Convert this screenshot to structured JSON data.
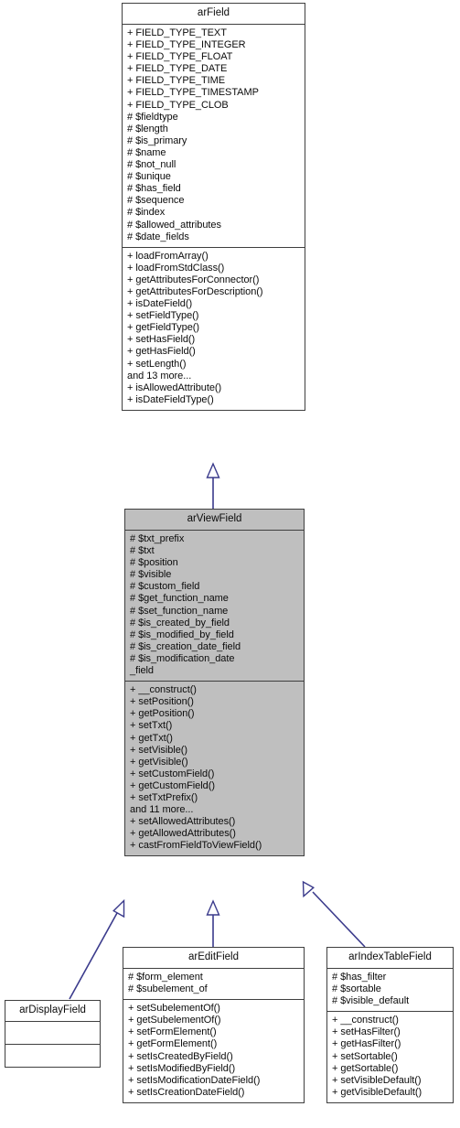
{
  "diagram": {
    "kind": "uml-class-inheritance-diagram",
    "title": "arField class hierarchy",
    "colors": {
      "node_border": "#3f3f3f",
      "node_background": "#ffffff",
      "highlight_background": "#bfbfbf",
      "edge_line": "#3b3b8c",
      "text": "#0b0b0b",
      "canvas": "#ffffff"
    }
  },
  "nodes": {
    "ar_field": {
      "name": "arField",
      "attributes": [
        "+ FIELD_TYPE_TEXT",
        "+ FIELD_TYPE_INTEGER",
        "+ FIELD_TYPE_FLOAT",
        "+ FIELD_TYPE_DATE",
        "+ FIELD_TYPE_TIME",
        "+ FIELD_TYPE_TIMESTAMP",
        "+ FIELD_TYPE_CLOB",
        "# $fieldtype",
        "# $length",
        "# $is_primary",
        "# $name",
        "# $not_null",
        "# $unique",
        "# $has_field",
        "# $sequence",
        "# $index",
        "# $allowed_attributes",
        "# $date_fields"
      ],
      "methods": [
        "+ loadFromArray()",
        "+ loadFromStdClass()",
        "+ getAttributesForConnector()",
        "+ getAttributesForDescription()",
        "+ isDateField()",
        "+ setFieldType()",
        "+ getFieldType()",
        "+ setHasField()",
        "+ getHasField()",
        "+ setLength()",
        "and 13 more...",
        "+ isAllowedAttribute()",
        "+ isDateFieldType()"
      ]
    },
    "ar_view_field": {
      "name": "arViewField",
      "attributes": [
        "# $txt_prefix",
        "# $txt",
        "# $position",
        "# $visible",
        "# $custom_field",
        "# $get_function_name",
        "# $set_function_name",
        "# $is_created_by_field",
        "# $is_modified_by_field",
        "# $is_creation_date_field",
        "# $is_modification_date\n_field"
      ],
      "methods": [
        "+ __construct()",
        "+ setPosition()",
        "+ getPosition()",
        "+ setTxt()",
        "+ getTxt()",
        "+ setVisible()",
        "+ getVisible()",
        "+ setCustomField()",
        "+ getCustomField()",
        "+ setTxtPrefix()",
        "and 11 more...",
        "+ setAllowedAttributes()",
        "+ getAllowedAttributes()",
        "+ castFromFieldToViewField()"
      ]
    },
    "ar_display_field": {
      "name": "arDisplayField",
      "attributes": [],
      "methods": []
    },
    "ar_edit_field": {
      "name": "arEditField",
      "attributes": [
        "# $form_element",
        "# $subelement_of"
      ],
      "methods": [
        "+ setSubelementOf()",
        "+ getSubelementOf()",
        "+ setFormElement()",
        "+ getFormElement()",
        "+ setIsCreatedByField()",
        "+ setIsModifiedByField()",
        "+ setIsModificationDateField()",
        "+ setIsCreationDateField()"
      ]
    },
    "ar_index_table_field": {
      "name": "arIndexTableField",
      "attributes": [
        "# $has_filter",
        "# $sortable",
        "# $visible_default"
      ],
      "methods": [
        "+ __construct()",
        "+ setHasFilter()",
        "+ getHasFilter()",
        "+ setSortable()",
        "+ getSortable()",
        "+ setVisibleDefault()",
        "+ getVisibleDefault()"
      ]
    }
  },
  "edges": [
    {
      "from": "ar_view_field",
      "to": "ar_field",
      "type": "generalization"
    },
    {
      "from": "ar_display_field",
      "to": "ar_view_field",
      "type": "generalization"
    },
    {
      "from": "ar_edit_field",
      "to": "ar_view_field",
      "type": "generalization"
    },
    {
      "from": "ar_index_table_field",
      "to": "ar_view_field",
      "type": "generalization"
    }
  ]
}
